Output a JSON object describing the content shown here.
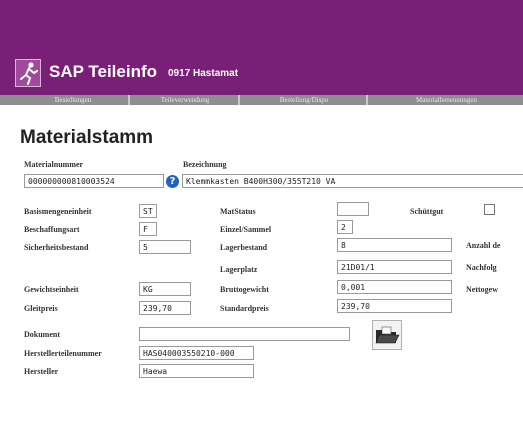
{
  "app": {
    "name": "SAP Teileinfo",
    "subtitle": "0917 Hastamat"
  },
  "tabs": [
    {
      "label": "Bestellungen"
    },
    {
      "label": "Teileverwendung"
    },
    {
      "label": "Bestellung/Dispo"
    },
    {
      "label": "Materialbenennungen"
    }
  ],
  "page_title": "Materialstamm",
  "header_fields": {
    "materialnummer": {
      "label": "Materialnummer",
      "value": "000000000810003524"
    },
    "bezeichnung": {
      "label": "Bezeichnung",
      "value": "Klemmkasten B400H300/355T210 VA"
    }
  },
  "fields": {
    "basismengeneinheit": {
      "label": "Basismengeneinheit",
      "value": "ST"
    },
    "beschaffungsart": {
      "label": "Beschaffungsart",
      "value": "F"
    },
    "sicherheitsbestand": {
      "label": "Sicherheitsbestand",
      "value": "5"
    },
    "gewichtseinheit": {
      "label": "Gewichtseinheit",
      "value": "KG"
    },
    "gleitpreis": {
      "label": "Gleitpreis",
      "value": "239,70"
    },
    "matstatus": {
      "label": "MatStatus",
      "value": ""
    },
    "einzel_sammel": {
      "label": "Einzel/Sammel",
      "value": "2"
    },
    "lagerbestand": {
      "label": "Lagerbestand",
      "value": "8"
    },
    "lagerplatz": {
      "label": "Lagerplatz",
      "value": "21D01/1"
    },
    "bruttogewicht": {
      "label": "Bruttogewicht",
      "value": "0,001"
    },
    "standardpreis": {
      "label": "Standardpreis",
      "value": "239,70"
    },
    "schuettgut": {
      "label": "Schüttgut",
      "checked": false
    },
    "anzahl": {
      "label": "Anzahl de"
    },
    "nachfolger": {
      "label": "Nachfolg"
    },
    "nettogewicht": {
      "label": "Nettogew"
    },
    "dokument": {
      "label": "Dokument",
      "value": ""
    },
    "herstellerteilenummer": {
      "label": "Herstellerteilenummer",
      "value": "HAS040003550210-000"
    },
    "hersteller": {
      "label": "Hersteller",
      "value": "Haewa"
    }
  },
  "icons": {
    "brand": "runner-icon",
    "help": "help-icon",
    "folder": "open-folder-icon"
  },
  "colors": {
    "header": "#7a1f78",
    "tabbar": "#8e8e8e",
    "help": "#1e63c4"
  }
}
